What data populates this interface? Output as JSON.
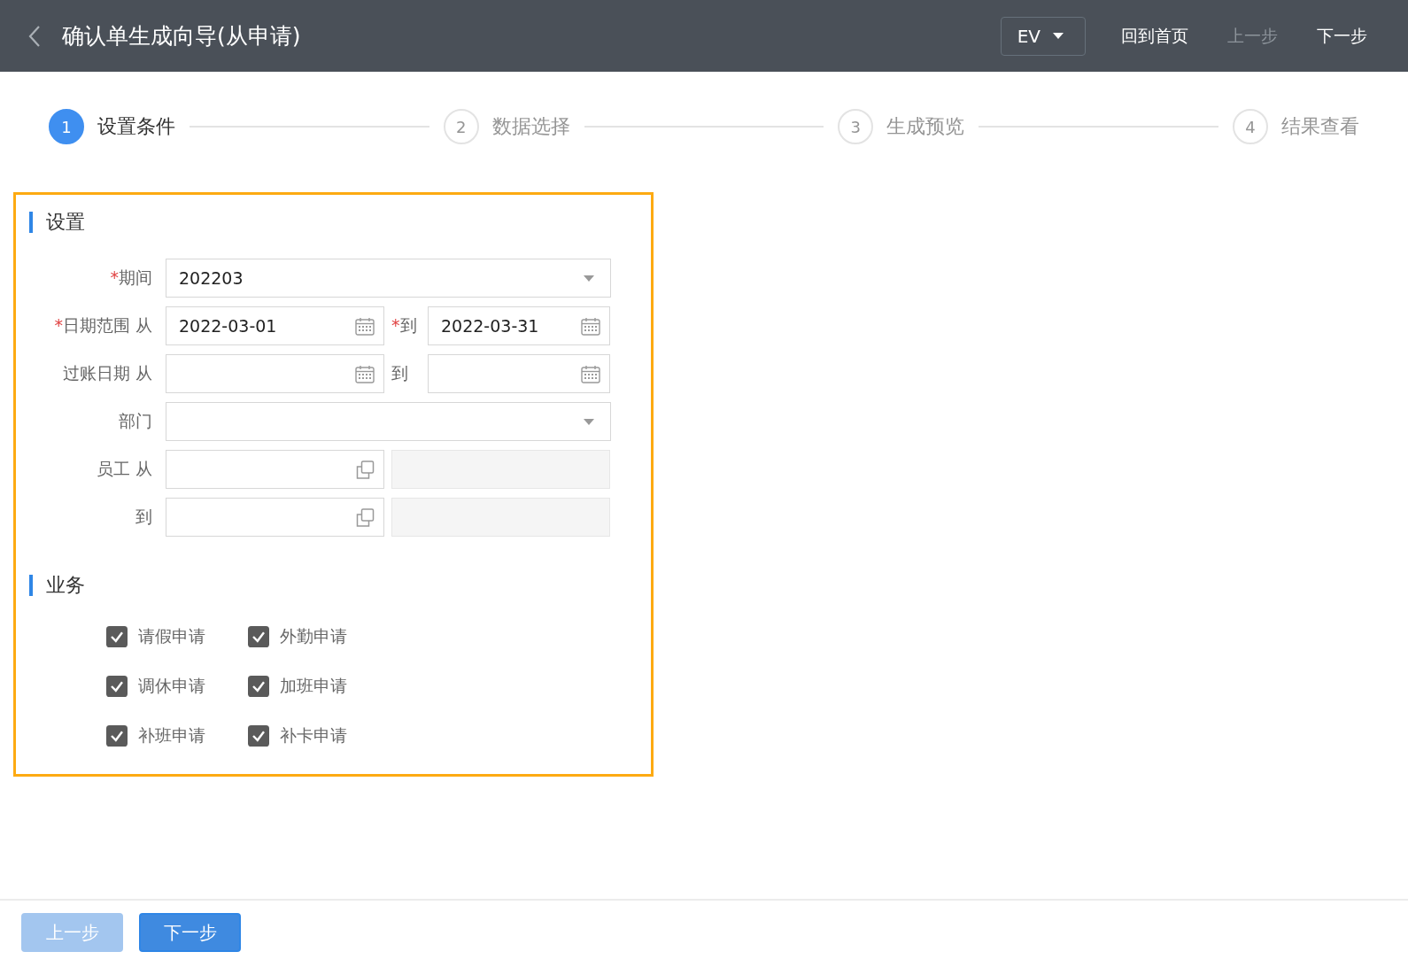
{
  "header": {
    "title": "确认单生成向导(从申请)",
    "language": "EV",
    "actions": [
      {
        "label": "回到首页",
        "disabled": false
      },
      {
        "label": "上一步",
        "disabled": true
      },
      {
        "label": "下一步",
        "disabled": false
      }
    ]
  },
  "steps": [
    {
      "number": "1",
      "label": "设置条件",
      "selected": true
    },
    {
      "number": "2",
      "label": "数据选择",
      "selected": false
    },
    {
      "number": "3",
      "label": "生成预览",
      "selected": false
    },
    {
      "number": "4",
      "label": "结果查看",
      "selected": false
    }
  ],
  "settings": {
    "title": "设置",
    "rows": [
      {
        "required_mark": "*",
        "label": "期间",
        "fields": [
          {
            "kind": "select",
            "value": "202203"
          }
        ]
      },
      {
        "required_mark": "*",
        "label": "日期范围 从",
        "fields": [
          {
            "kind": "date",
            "value": "2022-03-01"
          },
          {
            "kind": "label",
            "required_mark": "*",
            "text": "到"
          },
          {
            "kind": "date",
            "value": "2022-03-31"
          }
        ]
      },
      {
        "label": "过账日期 从",
        "fields": [
          {
            "kind": "date"
          },
          {
            "kind": "label",
            "text": "到"
          },
          {
            "kind": "date"
          }
        ]
      },
      {
        "label": "部门",
        "fields": [
          {
            "kind": "select"
          }
        ]
      },
      {
        "label": "员工 从",
        "fields": [
          {
            "kind": "lookup"
          },
          {
            "kind": "readonly"
          }
        ]
      },
      {
        "label": "到",
        "fields": [
          {
            "kind": "lookup"
          },
          {
            "kind": "readonly"
          }
        ]
      }
    ]
  },
  "business": {
    "title": "业务",
    "options": [
      {
        "label": "请假申请",
        "checked": true
      },
      {
        "label": "外勤申请",
        "checked": true
      },
      {
        "label": "调休申请",
        "checked": true
      },
      {
        "label": "加班申请",
        "checked": true
      },
      {
        "label": "补班申请",
        "checked": true
      },
      {
        "label": "补卡申请",
        "checked": true
      }
    ]
  },
  "footer": {
    "buttons": [
      {
        "label": "上一步",
        "disabled": true
      },
      {
        "label": "下一步",
        "disabled": false
      }
    ]
  }
}
